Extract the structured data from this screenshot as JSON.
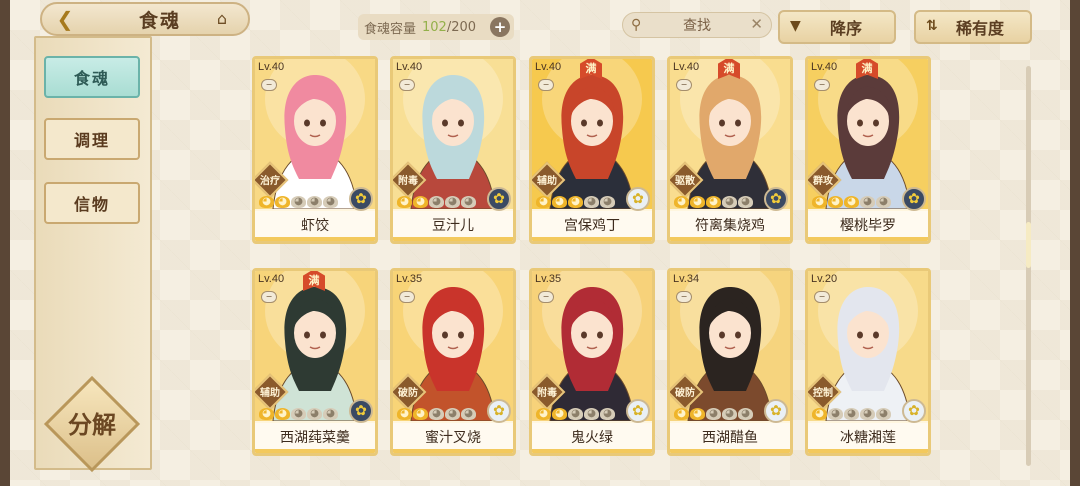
{
  "header": {
    "back_icon": "back-chevron-icon",
    "title": "食魂",
    "home_icon": "home-icon",
    "capacity_label": "食魂容量",
    "capacity_current": "102",
    "capacity_max": "/200",
    "add_icon": "plus-icon",
    "search_placeholder": "查找",
    "sort_order_label": "降序",
    "sort_by_label": "稀有度"
  },
  "sidebar": {
    "tabs": [
      {
        "label": "食魂",
        "active": true
      },
      {
        "label": "调理",
        "active": false
      },
      {
        "label": "信物",
        "active": false
      }
    ],
    "decompose_label": "分解"
  },
  "colors": {
    "card_border": "#e9c978",
    "active_tab": "#a9ddd3",
    "star_on": "#efb52a"
  },
  "cards": [
    {
      "level": "Lv.40",
      "max": false,
      "role": "治疗",
      "stars": 2,
      "element": "dark",
      "name": "虾饺",
      "hair": "#f08aa0",
      "robe": "#ffffff",
      "bg": "#f8d985"
    },
    {
      "level": "Lv.40",
      "max": false,
      "role": "附毒",
      "stars": 2,
      "element": "dark",
      "name": "豆汁儿",
      "hair": "#bcd9dc",
      "robe": "#b8483c",
      "bg": "#f8df95"
    },
    {
      "level": "Lv.40",
      "max": true,
      "max_label": "满",
      "role": "辅助",
      "stars": 3,
      "element": "light",
      "name": "宫保鸡丁",
      "hair": "#c8452a",
      "robe": "#2b2f3a",
      "bg": "#f6c94e"
    },
    {
      "level": "Lv.40",
      "max": true,
      "max_label": "满",
      "role": "驱散",
      "stars": 3,
      "element": "dark",
      "name": "符离集烧鸡",
      "hair": "#e1a86b",
      "robe": "#2f2f38",
      "bg": "#f9dd8f"
    },
    {
      "level": "Lv.40",
      "max": true,
      "max_label": "满",
      "role": "群攻",
      "stars": 3,
      "element": "dark",
      "name": "樱桃毕罗",
      "hair": "#5b3b3a",
      "robe": "#c9d7e8",
      "bg": "#f6cf60"
    },
    {
      "level": "Lv.40",
      "max": true,
      "max_label": "满",
      "role": "辅助",
      "stars": 2,
      "element": "dark",
      "name": "西湖莼菜羹",
      "hair": "#2e3a33",
      "robe": "#cfe3d6",
      "bg": "#f7d47a"
    },
    {
      "level": "Lv.35",
      "max": false,
      "role": "破防",
      "stars": 2,
      "element": "light",
      "name": "蜜汁叉烧",
      "hair": "#c9342b",
      "robe": "#c2532b",
      "bg": "#f8d477"
    },
    {
      "level": "Lv.35",
      "max": false,
      "role": "附毒",
      "stars": 2,
      "element": "light",
      "name": "鬼火绿",
      "hair": "#b12c35",
      "robe": "#2f2a35",
      "bg": "#f7d27a"
    },
    {
      "level": "Lv.34",
      "max": false,
      "role": "破防",
      "stars": 2,
      "element": "light",
      "name": "西湖醋鱼",
      "hair": "#2b2420",
      "robe": "#7c4a2d",
      "bg": "#f6d47e"
    },
    {
      "level": "Lv.20",
      "max": false,
      "role": "控制",
      "stars": 1,
      "element": "light",
      "name": "冰糖湘莲",
      "hair": "#e3e6ee",
      "robe": "#eef1f5",
      "bg": "#f7da8a"
    }
  ]
}
